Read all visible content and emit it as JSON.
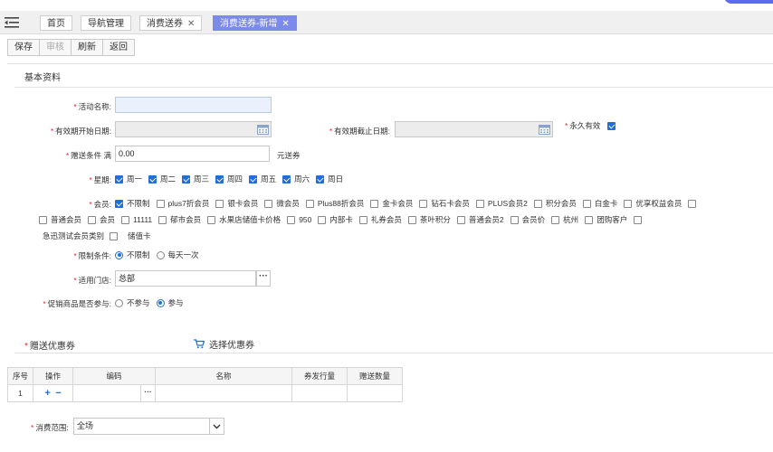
{
  "tabs": [
    {
      "label": "首页",
      "closable": false,
      "active": false
    },
    {
      "label": "导航管理",
      "closable": false,
      "active": false
    },
    {
      "label": "消费送券",
      "closable": true,
      "active": false
    },
    {
      "label": "消费送券-新增",
      "closable": true,
      "active": true
    }
  ],
  "toolbar": {
    "save": "保存",
    "audit": "审核",
    "refresh": "刷新",
    "back": "返回"
  },
  "basic": {
    "title": "基本资料",
    "activity_name_label": "活动名称:",
    "activity_name_value": "",
    "start_label": "有效期开始日期:",
    "end_label": "有效期截止日期:",
    "permanent_label": "永久有效",
    "condition_label": "赠送条件 满",
    "condition_value": "0.00",
    "condition_suffix": "元送券",
    "week_label": "星期:",
    "weekdays": [
      "周一",
      "周二",
      "周三",
      "周四",
      "周五",
      "周六",
      "周日"
    ],
    "member_label": "会员:",
    "members_row1": [
      {
        "t": "不限制",
        "on": true
      },
      {
        "t": "plus7折会员",
        "on": false
      },
      {
        "t": "银卡会员",
        "on": false
      },
      {
        "t": "微会员",
        "on": false
      },
      {
        "t": "Plus88折会员",
        "on": false
      },
      {
        "t": "金卡会员",
        "on": false
      },
      {
        "t": "钻石卡会员",
        "on": false
      },
      {
        "t": "PLUS会员2",
        "on": false
      },
      {
        "t": "积分会员",
        "on": false
      },
      {
        "t": "白金卡",
        "on": false
      },
      {
        "t": "优享权益会员",
        "on": false
      }
    ],
    "members_row2": [
      "普通会员",
      "会员",
      "11111",
      "郁市会员",
      "水果店储值卡价格",
      "950",
      "内部卡",
      "礼券会员",
      "茶叶积分",
      "普通会员2",
      "会员价",
      "杭州",
      "团购客户"
    ],
    "members_row3": [
      "急迅测试会员类别",
      "储值卡"
    ],
    "limit_label": "限制条件:",
    "limit_options": [
      "不限制",
      "每天一次"
    ],
    "store_label": "适用门店:",
    "store_value": "总部",
    "promo_label": "促销商品是否参与:",
    "promo_options": [
      "不参与",
      "参与"
    ]
  },
  "coupon": {
    "title": "赠送优惠券",
    "select_label": "选择优惠券",
    "headers": [
      "序号",
      "操作",
      "编码",
      "名称",
      "券发行量",
      "赠送数量"
    ],
    "rows": [
      {
        "index": "1",
        "code": "",
        "name": "",
        "issued": "",
        "qty": ""
      }
    ],
    "scope_label": "消费范围:",
    "scope_value": "全场"
  },
  "colors": {
    "accent": "#7c8ae9",
    "check": "#1e6fd9",
    "required": "#e22233"
  }
}
